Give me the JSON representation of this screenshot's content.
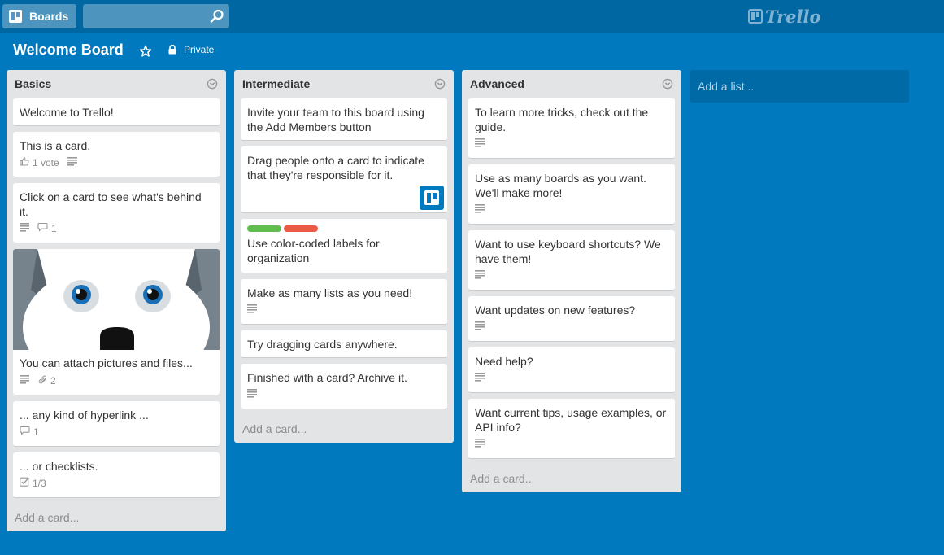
{
  "header": {
    "boards_label": "Boards",
    "search": {
      "value": "",
      "placeholder": ""
    },
    "logo_text": "Trello"
  },
  "board": {
    "title": "Welcome Board",
    "visibility": "Private"
  },
  "colors": {
    "background": "#0079bf",
    "header": "#0067a3",
    "list_bg": "#e2e4e6",
    "label_green": "#61bd4f",
    "label_red": "#eb5a46"
  },
  "lists": [
    {
      "title": "Basics",
      "add_card": "Add a card...",
      "cards": [
        {
          "text": "Welcome to Trello!"
        },
        {
          "text": "This is a card.",
          "votes": "1 vote"
        },
        {
          "text": "Click on a card to see what's behind it.",
          "comments": "1"
        },
        {
          "text": "You can attach pictures and files...",
          "attachments": "2",
          "cover": "husky-cover-image"
        },
        {
          "text": "... any kind of hyperlink ...",
          "comments": "1"
        },
        {
          "text": "... or checklists.",
          "checklist": "1/3"
        }
      ]
    },
    {
      "title": "Intermediate",
      "add_card": "Add a card...",
      "cards": [
        {
          "text": "Invite your team to this board using the Add Members button"
        },
        {
          "text": "Drag people onto a card to indicate that they're responsible for it.",
          "member": "trello-member-avatar"
        },
        {
          "text": "Use color-coded labels for organization",
          "labels": [
            "green",
            "red"
          ]
        },
        {
          "text": "Make as many lists as you need!"
        },
        {
          "text": "Try dragging cards anywhere."
        },
        {
          "text": "Finished with a card? Archive it."
        }
      ]
    },
    {
      "title": "Advanced",
      "add_card": "Add a card...",
      "cards": [
        {
          "text": "To learn more tricks, check out the guide."
        },
        {
          "text": "Use as many boards as you want. We'll make more!"
        },
        {
          "text": "Want to use keyboard shortcuts? We have them!"
        },
        {
          "text": "Want updates on new features?"
        },
        {
          "text": "Need help?"
        },
        {
          "text": "Want current tips, usage examples, or API info?"
        }
      ]
    }
  ],
  "add_list": "Add a list..."
}
